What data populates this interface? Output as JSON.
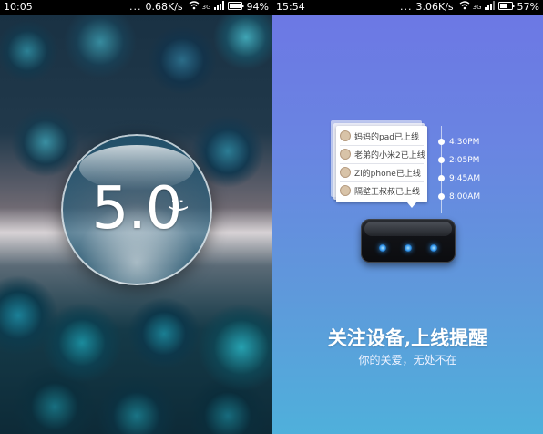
{
  "left_screen": {
    "status_bar": {
      "time": "10:05",
      "dots": "...",
      "speed": "0.68K/s",
      "signal": "3G",
      "battery": "94%",
      "icons": [
        "wifi-icon",
        "signal-icon",
        "battery-icon"
      ]
    },
    "splash": {
      "version": "5.0",
      "smiley": ":)",
      "bubble_colors": {
        "rim": "#ffffff",
        "tint": "#2f7f92"
      }
    }
  },
  "right_screen": {
    "status_bar": {
      "time": "15:54",
      "dots": "...",
      "speed": "3.06K/s",
      "signal": "3G",
      "battery": "57%",
      "icons": [
        "wifi-icon",
        "signal-icon",
        "battery-icon"
      ]
    },
    "notifications": [
      {
        "text": "妈妈的pad已上线",
        "time": "4:30PM"
      },
      {
        "text": "老弟的小米2已上线",
        "time": "2:05PM"
      },
      {
        "text": "Zl的phone已上线",
        "time": "9:45AM"
      },
      {
        "text": "隔壁王叔叔已上线",
        "time": "8:00AM"
      }
    ],
    "headline": "关注设备,上线提醒",
    "subline": "你的关爱，无处不在",
    "colors": {
      "gradient_top": "#6c78e4",
      "gradient_bottom": "#4fb0db",
      "led": "#2a8ee8"
    }
  }
}
